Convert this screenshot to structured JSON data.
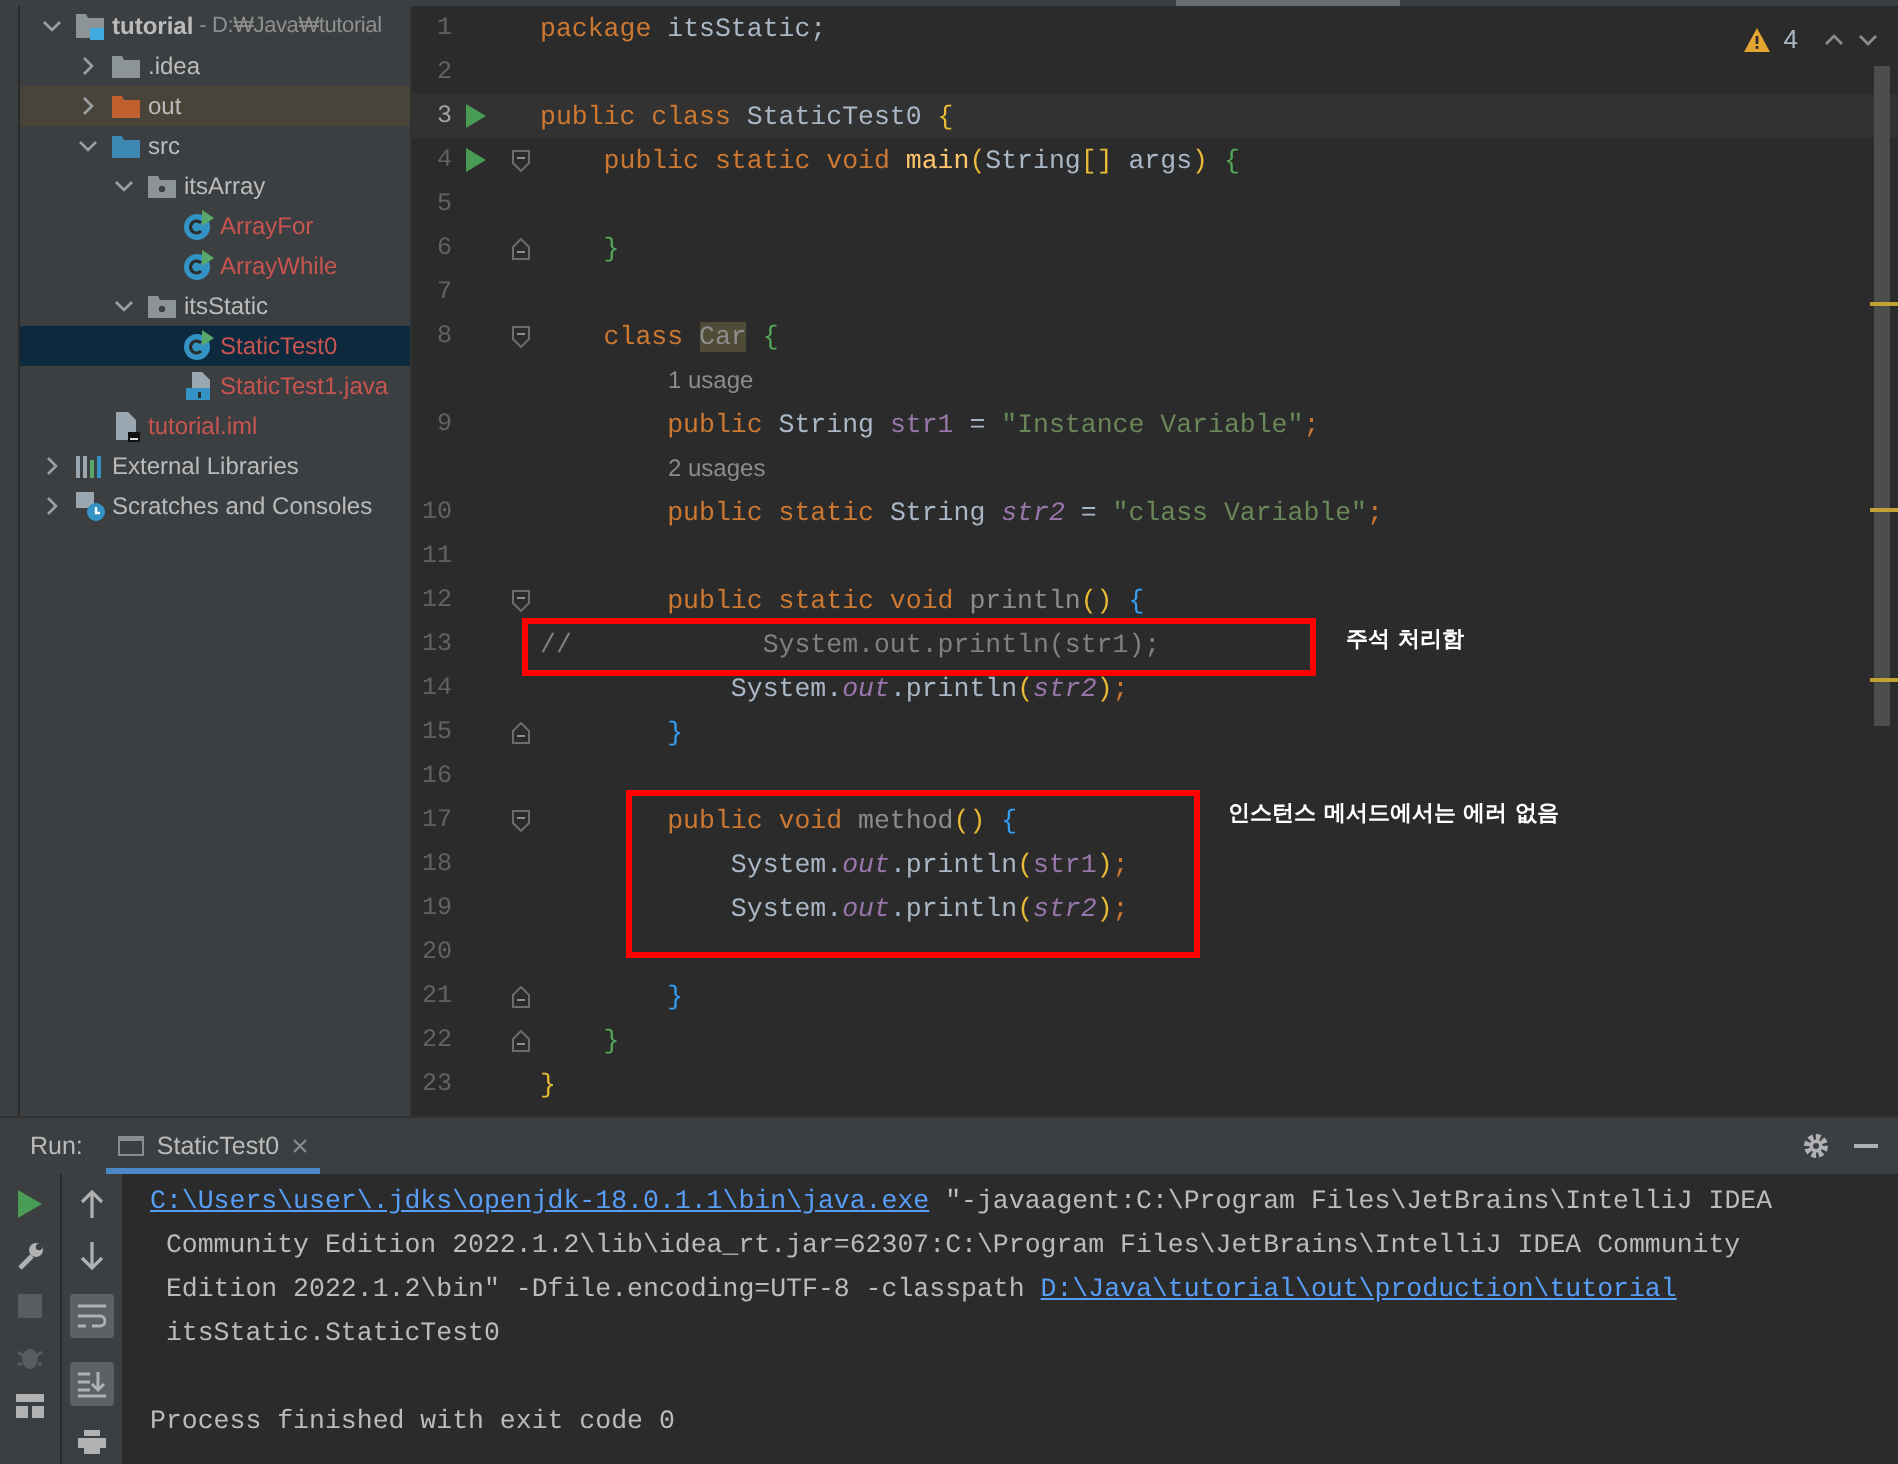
{
  "project_tree": {
    "items": [
      {
        "label": "tutorial",
        "path_hint": " - D:₩Java₩tutorial",
        "kind": "module",
        "expanded": true,
        "selected": false,
        "untracked": false,
        "children": [
          {
            "label": ".idea",
            "kind": "folder",
            "expanded": false,
            "selected": false,
            "untracked": false
          },
          {
            "label": "out",
            "kind": "excluded",
            "expanded": false,
            "selected": false,
            "untracked": false
          },
          {
            "label": "src",
            "kind": "source",
            "expanded": true,
            "selected": false,
            "untracked": false,
            "children": [
              {
                "label": "itsArray",
                "kind": "package",
                "expanded": true,
                "selected": false,
                "untracked": false,
                "children": [
                  {
                    "label": "ArrayFor",
                    "kind": "class",
                    "selected": false,
                    "untracked": true
                  },
                  {
                    "label": "ArrayWhile",
                    "kind": "class",
                    "selected": false,
                    "untracked": true
                  }
                ]
              },
              {
                "label": "itsStatic",
                "kind": "package",
                "expanded": true,
                "selected": false,
                "untracked": false,
                "children": [
                  {
                    "label": "StaticTest0",
                    "kind": "class",
                    "selected": true,
                    "untracked": true
                  },
                  {
                    "label": "StaticTest1.java",
                    "kind": "java",
                    "selected": false,
                    "untracked": true
                  }
                ]
              }
            ]
          },
          {
            "label": "tutorial.iml",
            "kind": "iml",
            "selected": false,
            "untracked": true
          }
        ]
      },
      {
        "label": "External Libraries",
        "kind": "libraries",
        "expanded": false,
        "selected": false,
        "untracked": false
      },
      {
        "label": "Scratches and Consoles",
        "kind": "scratches",
        "expanded": false,
        "selected": false,
        "untracked": false
      }
    ]
  },
  "editor": {
    "warnings": "4",
    "lines": [
      {
        "kind": "code",
        "number": "1",
        "run": false,
        "current": false,
        "tokens": [
          {
            "text": "package ",
            "kind": "keyword"
          },
          {
            "text": "itsStatic;",
            "kind": "plain"
          }
        ]
      },
      {
        "kind": "code",
        "number": "2",
        "run": false,
        "current": false
      },
      {
        "kind": "code",
        "number": "3",
        "run": true,
        "current": true,
        "tokens": [
          {
            "text": "public class ",
            "kind": "keyword"
          },
          {
            "text": "StaticTest0 ",
            "kind": "plain"
          },
          {
            "text": "{",
            "kind": "bracket1"
          }
        ]
      },
      {
        "kind": "code",
        "number": "4",
        "run": true,
        "current": false,
        "fold_start": true,
        "tokens": [
          {
            "text": "    public static void ",
            "kind": "keyword"
          },
          {
            "text": "main",
            "kind": "method"
          },
          {
            "text": "(",
            "kind": "bracket1"
          },
          {
            "text": "String",
            "kind": "plain"
          },
          {
            "text": "[]",
            "kind": "bracket1"
          },
          {
            "text": " args",
            "kind": "plain"
          },
          {
            "text": ")",
            "kind": "bracket1"
          },
          {
            "text": " {",
            "kind": "bracket2"
          }
        ]
      },
      {
        "kind": "code",
        "number": "5",
        "run": false,
        "current": false
      },
      {
        "kind": "code",
        "number": "6",
        "run": false,
        "current": false,
        "fold_end": true,
        "tokens": [
          {
            "text": "    }",
            "kind": "bracket2"
          }
        ]
      },
      {
        "kind": "code",
        "number": "7",
        "run": false,
        "current": false
      },
      {
        "kind": "code",
        "number": "8",
        "run": false,
        "current": false,
        "fold_start": true,
        "tokens": [
          {
            "text": "    class ",
            "kind": "keyword"
          },
          {
            "text": "Car",
            "kind": "unused"
          },
          {
            "text": " {",
            "kind": "bracket2"
          }
        ]
      },
      {
        "kind": "hint",
        "text": "1 usage"
      },
      {
        "kind": "code",
        "number": "9",
        "run": false,
        "current": false,
        "tokens": [
          {
            "text": "        public ",
            "kind": "keyword"
          },
          {
            "text": "String ",
            "kind": "plain"
          },
          {
            "text": "str1",
            "kind": "field"
          },
          {
            "text": " = ",
            "kind": "plain"
          },
          {
            "text": "\"Instance Variable\"",
            "kind": "string"
          },
          {
            "text": ";",
            "kind": "keyword"
          }
        ]
      },
      {
        "kind": "hint",
        "text": "2 usages"
      },
      {
        "kind": "code",
        "number": "10",
        "run": false,
        "current": false,
        "tokens": [
          {
            "text": "        public static ",
            "kind": "keyword"
          },
          {
            "text": "String ",
            "kind": "plain"
          },
          {
            "text": "str2",
            "kind": "static"
          },
          {
            "text": " = ",
            "kind": "plain"
          },
          {
            "text": "\"class Variable\"",
            "kind": "string"
          },
          {
            "text": ";",
            "kind": "keyword"
          }
        ]
      },
      {
        "kind": "code",
        "number": "11",
        "run": false,
        "current": false
      },
      {
        "kind": "code",
        "number": "12",
        "run": false,
        "current": false,
        "fold_start": true,
        "tokens": [
          {
            "text": "        public static void ",
            "kind": "keyword"
          },
          {
            "text": "println",
            "kind": "dim"
          },
          {
            "text": "()",
            "kind": "bracket1"
          },
          {
            "text": " {",
            "kind": "bracket3"
          }
        ]
      },
      {
        "kind": "code",
        "number": "13",
        "run": false,
        "current": false,
        "tokens": [
          {
            "text": "//            System.out.println(str1);",
            "kind": "comment"
          }
        ]
      },
      {
        "kind": "code",
        "number": "14",
        "run": false,
        "current": false,
        "tokens": [
          {
            "text": "            System.",
            "kind": "plain"
          },
          {
            "text": "out",
            "kind": "static"
          },
          {
            "text": ".println",
            "kind": "plain"
          },
          {
            "text": "(",
            "kind": "bracket1"
          },
          {
            "text": "str2",
            "kind": "static"
          },
          {
            "text": ")",
            "kind": "bracket1"
          },
          {
            "text": ";",
            "kind": "keyword"
          }
        ]
      },
      {
        "kind": "code",
        "number": "15",
        "run": false,
        "current": false,
        "fold_end": true,
        "tokens": [
          {
            "text": "        }",
            "kind": "bracket3"
          }
        ]
      },
      {
        "kind": "code",
        "number": "16",
        "run": false,
        "current": false
      },
      {
        "kind": "code",
        "number": "17",
        "run": false,
        "current": false,
        "fold_start": true,
        "tokens": [
          {
            "text": "        public void ",
            "kind": "keyword"
          },
          {
            "text": "method",
            "kind": "dim"
          },
          {
            "text": "()",
            "kind": "bracket1"
          },
          {
            "text": " {",
            "kind": "bracket3"
          }
        ]
      },
      {
        "kind": "code",
        "number": "18",
        "run": false,
        "current": false,
        "tokens": [
          {
            "text": "            System.",
            "kind": "plain"
          },
          {
            "text": "out",
            "kind": "static"
          },
          {
            "text": ".println",
            "kind": "plain"
          },
          {
            "text": "(",
            "kind": "bracket1"
          },
          {
            "text": "str1",
            "kind": "field"
          },
          {
            "text": ")",
            "kind": "bracket1"
          },
          {
            "text": ";",
            "kind": "keyword"
          }
        ]
      },
      {
        "kind": "code",
        "number": "19",
        "run": false,
        "current": false,
        "tokens": [
          {
            "text": "            System.",
            "kind": "plain"
          },
          {
            "text": "out",
            "kind": "static"
          },
          {
            "text": ".println",
            "kind": "plain"
          },
          {
            "text": "(",
            "kind": "bracket1"
          },
          {
            "text": "str2",
            "kind": "static"
          },
          {
            "text": ")",
            "kind": "bracket1"
          },
          {
            "text": ";",
            "kind": "keyword"
          }
        ]
      },
      {
        "kind": "code",
        "number": "20",
        "run": false,
        "current": false
      },
      {
        "kind": "code",
        "number": "21",
        "run": false,
        "current": false,
        "fold_end": true,
        "tokens": [
          {
            "text": "        }",
            "kind": "bracket3"
          }
        ]
      },
      {
        "kind": "code",
        "number": "22",
        "run": false,
        "current": false,
        "fold_end": true,
        "tokens": [
          {
            "text": "    }",
            "kind": "bracket2"
          }
        ]
      },
      {
        "kind": "code",
        "number": "23",
        "run": false,
        "current": false,
        "tokens": [
          {
            "text": "}",
            "kind": "bracket1"
          }
        ]
      }
    ],
    "annotations": [
      {
        "text": "주석 처리함"
      },
      {
        "text": "인스턴스 메서드에서는 에러 없음"
      }
    ]
  },
  "run_panel": {
    "label": "Run:",
    "tab": "StaticTest0",
    "output": [
      [
        {
          "text": "C:\\Users\\user\\.jdks\\openjdk-18.0.1.1\\bin\\java.exe",
          "kind": "link"
        },
        {
          "text": " \"-javaagent:C:\\Program Files\\JetBrains\\IntelliJ IDEA",
          "kind": "plain"
        }
      ],
      [
        {
          "text": " Community Edition 2022.1.2\\lib\\idea_rt.jar=62307:C:\\Program Files\\JetBrains\\IntelliJ IDEA Community",
          "kind": "plain"
        }
      ],
      [
        {
          "text": " Edition 2022.1.2\\bin\" -Dfile.encoding=UTF-8 -classpath ",
          "kind": "plain"
        },
        {
          "text": "D:\\Java\\tutorial\\out\\production\\tutorial",
          "kind": "link"
        }
      ],
      [
        {
          "text": " itsStatic.StaticTest0",
          "kind": "plain"
        }
      ]
    ],
    "exit_message": "Process finished with exit code 0"
  }
}
